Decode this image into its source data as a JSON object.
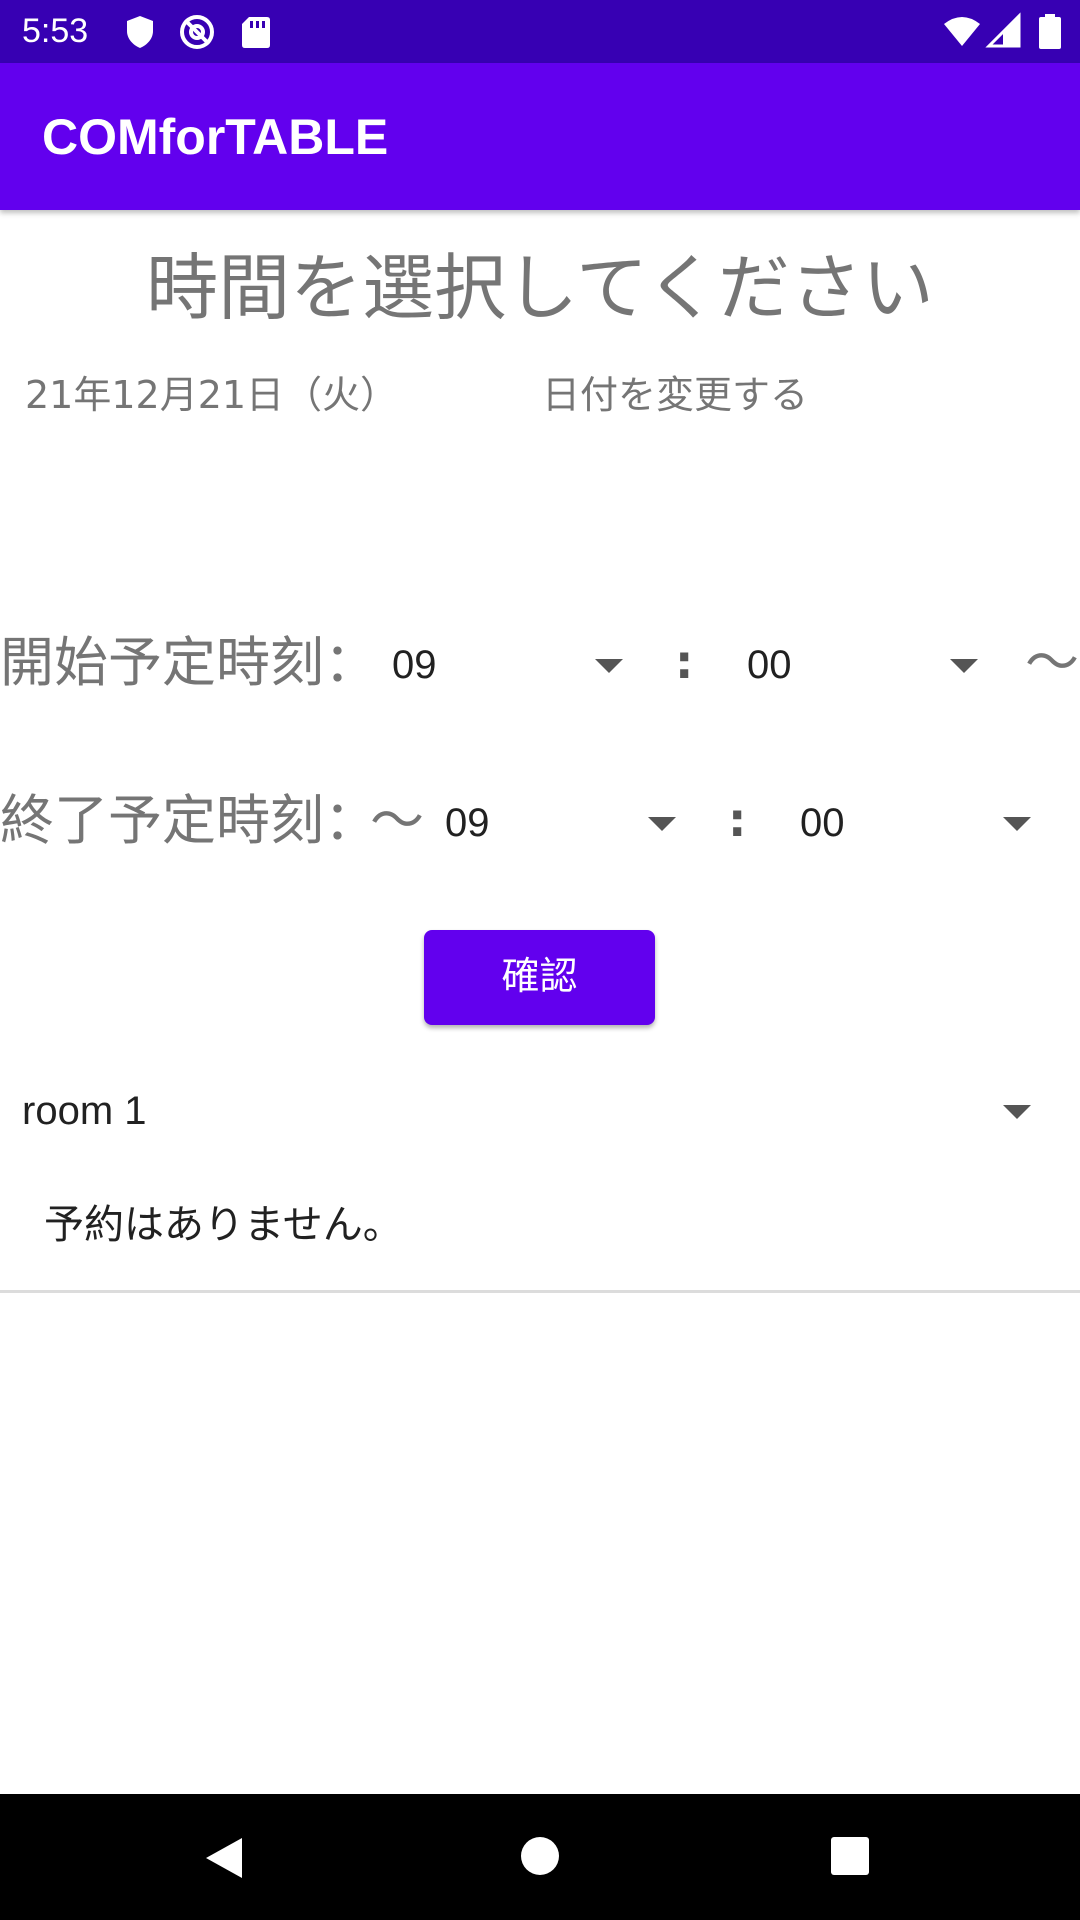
{
  "status_bar": {
    "time": "5:53",
    "left_icons": [
      "shield-icon",
      "no-data-icon",
      "sd-card-icon"
    ],
    "right_icons": [
      "wifi-icon",
      "signal-icon",
      "battery-icon"
    ],
    "color": "#3700b3"
  },
  "app_bar": {
    "title": "COMforTABLE",
    "color": "#6200ee"
  },
  "main": {
    "heading": "時間を選択してください",
    "date": "21年12月21日（火）",
    "change_date": "日付を変更する",
    "start": {
      "label": "開始予定時刻：",
      "hour": "09",
      "colon": ":",
      "minute": "00",
      "suffix": "〜"
    },
    "end": {
      "label": "終了予定時刻：",
      "prefix": "〜",
      "hour": "09",
      "colon": ":",
      "minute": "00"
    },
    "confirm_label": "確認",
    "room": "room 1",
    "no_reservations": "予約はありません。"
  },
  "nav_bar": {
    "buttons": [
      "back-icon",
      "home-icon",
      "recents-icon"
    ]
  },
  "colors": {
    "accent": "#6200ee",
    "status": "#3700b3",
    "secondary_text": "#757575",
    "primary_text": "#212121"
  }
}
